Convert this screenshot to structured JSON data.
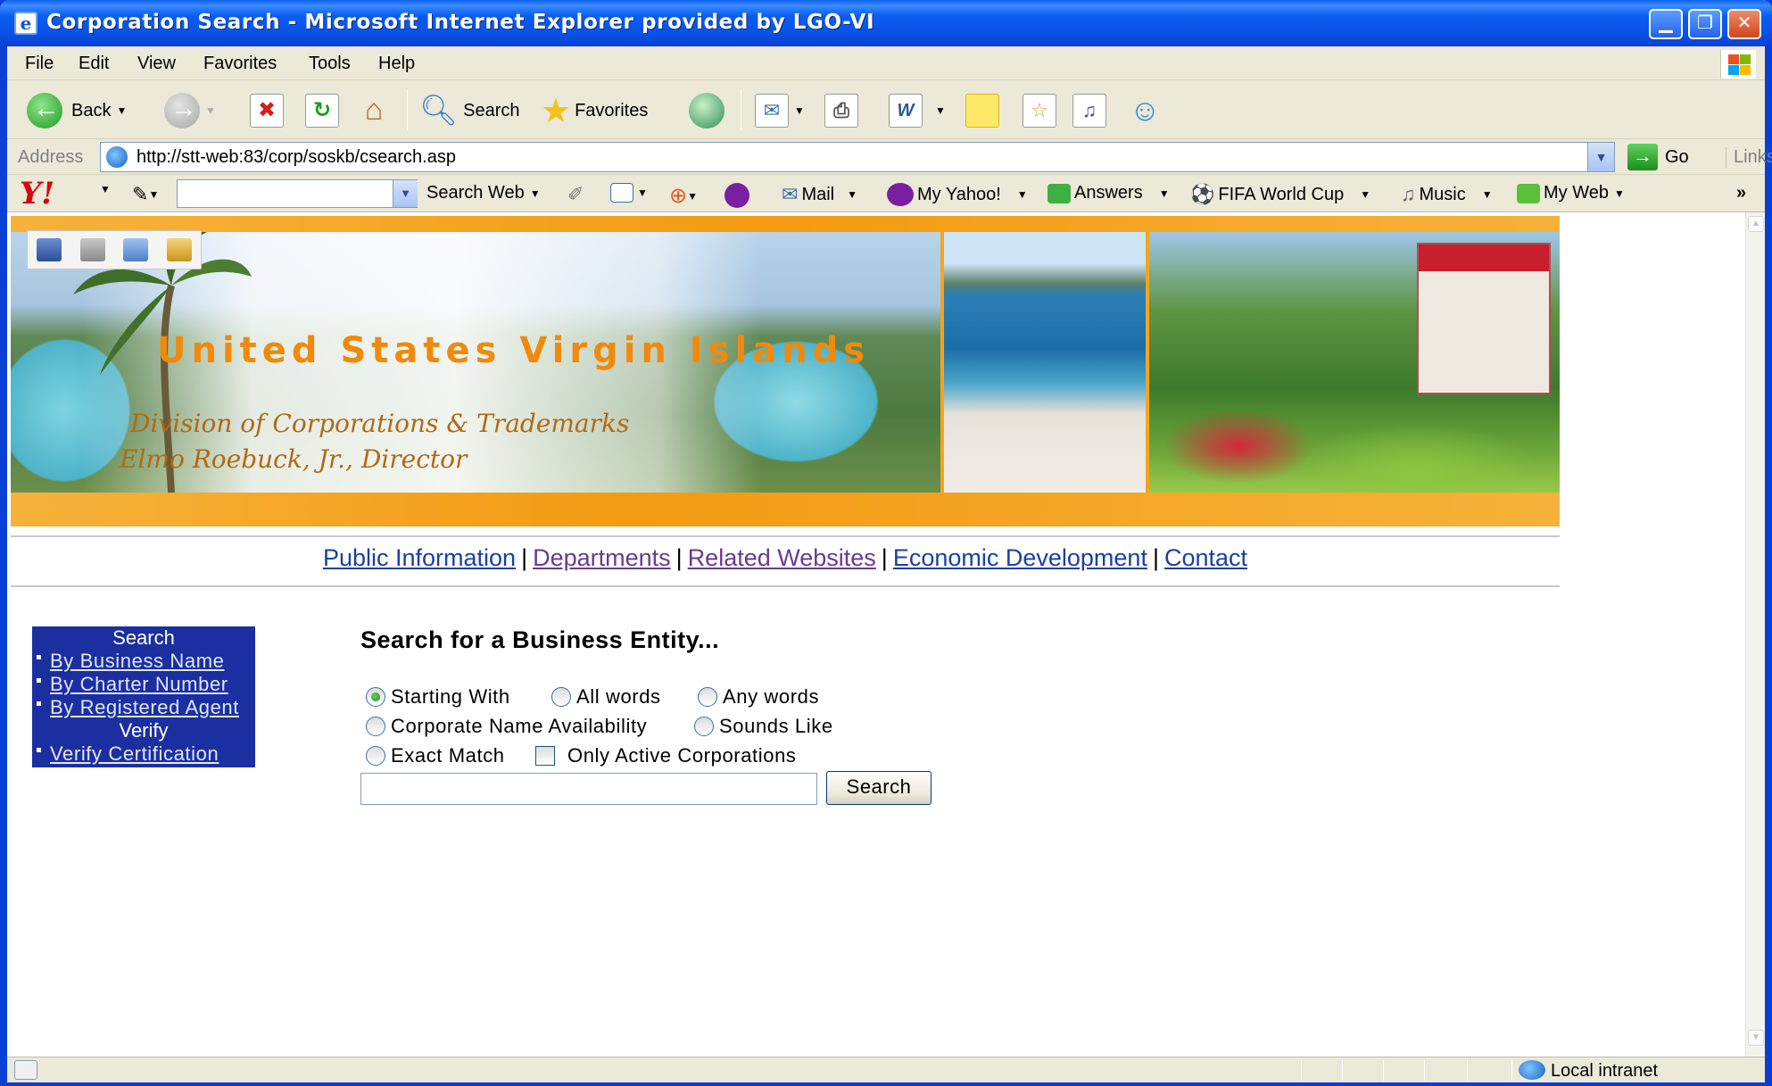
{
  "window": {
    "title": "Corporation Search - Microsoft Internet Explorer provided by LGO-VI",
    "app_icon": "ie-page-icon",
    "controls": [
      "minimize-icon",
      "maximize-icon",
      "close-icon"
    ]
  },
  "menubar": {
    "items": [
      "File",
      "Edit",
      "View",
      "Favorites",
      "Tools",
      "Help"
    ]
  },
  "toolbar": {
    "back_label": "Back",
    "search_label": "Search",
    "favorites_label": "Favorites"
  },
  "address": {
    "label": "Address",
    "url": "http://stt-web:83/corp/soskb/csearch.asp",
    "go_label": "Go",
    "links_label": "Links"
  },
  "yahoo_toolbar": {
    "search_web_label": "Search Web",
    "mail_label": "Mail",
    "my_yahoo_label": "My Yahoo!",
    "answers_label": "Answers",
    "fifa_label": "FIFA World Cup",
    "music_label": "Music",
    "my_web_label": "My Web",
    "chevron": "»"
  },
  "banner": {
    "title": "United States Virgin Islands",
    "subtitle": "Division of Corporations & Trademarks",
    "director": "Elmo Roebuck, Jr., Director"
  },
  "nav": {
    "links": [
      "Public Information",
      "Departments",
      "Related Websites",
      "Economic Development",
      "Contact"
    ],
    "separator": "|"
  },
  "sidemenu": {
    "search_header": "Search",
    "search_items": [
      "By Business Name",
      "By Charter Number",
      "By Registered Agent"
    ],
    "verify_header": "Verify",
    "verify_items": [
      "Verify Certification"
    ]
  },
  "form": {
    "title": "Search for a Business Entity...",
    "options": {
      "starting_with": "Starting With",
      "all_words": "All words",
      "any_words": "Any words",
      "corporate_name_availability": "Corporate Name Availability",
      "sounds_like": "Sounds Like",
      "exact_match": "Exact Match",
      "only_active": "Only Active Corporations"
    },
    "selected_option": "Starting With",
    "only_active_checked": false,
    "search_value": "",
    "search_button": "Search"
  },
  "statusbar": {
    "zone": "Local intranet"
  }
}
